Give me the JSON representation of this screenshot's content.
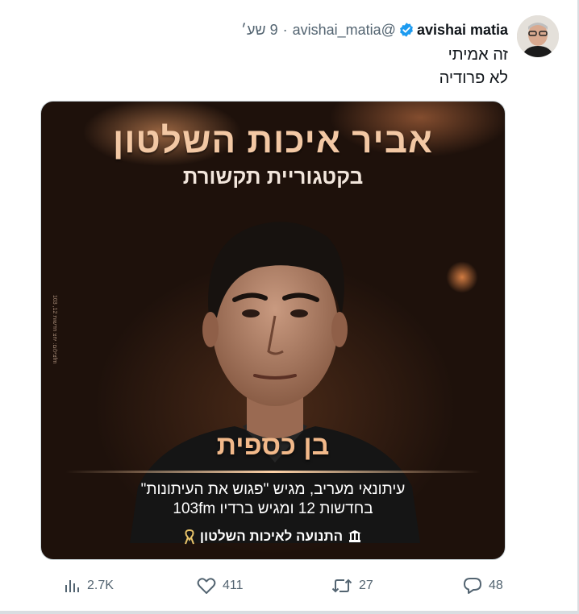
{
  "tweet": {
    "author": {
      "display_name": "avishai matia",
      "handle": "@avishai_matia",
      "time": "9 שע׳",
      "separator": "·"
    },
    "text_lines": [
      "זה אמיתי",
      "לא פרודיה"
    ]
  },
  "media": {
    "title": "אביר איכות השלטון",
    "subtitle": "בקטגוריית תקשורת",
    "person_name": "בן כספית",
    "description_lines": [
      "עיתונאי מעריב, מגיש \"פגוש את העיתונות\"",
      "בחדשות 12 ומגיש ברדיו 103fm"
    ],
    "organization": "התנועה לאיכות השלטון",
    "photo_credit": "צילום: יחצ חדשות 12, 103fm"
  },
  "actions": {
    "views": "2.7K",
    "likes": "411",
    "retweets": "27",
    "replies": "48"
  },
  "colors": {
    "verified": "#1d9bf0",
    "text_secondary": "#536471",
    "title_accent": "#f3c8a4"
  }
}
